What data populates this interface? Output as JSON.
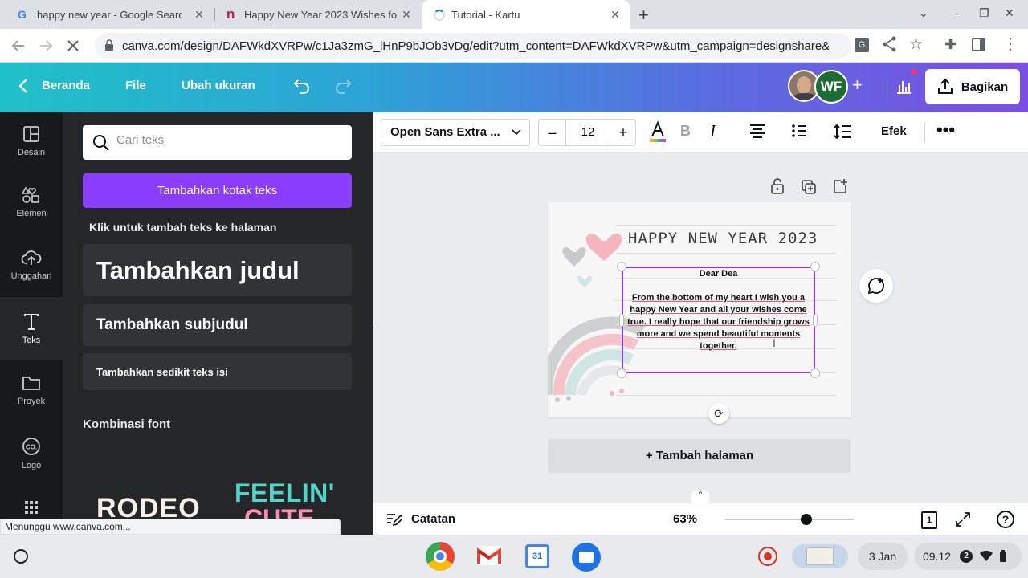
{
  "browser": {
    "tabs": [
      {
        "title": "happy new year - Google Search",
        "favicon": "google"
      },
      {
        "title": "Happy New Year 2023 Wishes fo",
        "favicon": "n-logo"
      },
      {
        "title": "Tutorial - Kartu",
        "favicon": "loading",
        "active": true
      }
    ],
    "url": "canva.com/design/DAFWkdXVRPw/c1Ja3zmG_lHnP9bJOb3vDg/edit?utm_content=DAFWkdXVRPw&utm_campaign=designshare&u...",
    "status": "Menunggu www.canva.com..."
  },
  "header": {
    "back_label": "Beranda",
    "file_label": "File",
    "resize_label": "Ubah ukuran",
    "avatar_initials": "WF",
    "share_label": "Bagikan"
  },
  "rail": [
    {
      "label": "Desain",
      "icon": "layout-icon"
    },
    {
      "label": "Elemen",
      "icon": "shapes-icon"
    },
    {
      "label": "Unggahan",
      "icon": "cloud-upload-icon"
    },
    {
      "label": "Teks",
      "icon": "text-icon",
      "active": true
    },
    {
      "label": "Proyek",
      "icon": "folder-icon"
    },
    {
      "label": "Logo",
      "icon": "logo-icon"
    }
  ],
  "panel": {
    "search_placeholder": "Cari teks",
    "add_textbox": "Tambahkan kotak teks",
    "hint": "Klik untuk tambah teks ke halaman",
    "heading": "Tambahkan judul",
    "subheading": "Tambahkan subjudul",
    "body": "Tambahkan sedikit teks isi",
    "combos_label": "Kombinasi font",
    "combo1": "RODEO",
    "combo2": "FEELIN'",
    "combo2b": "CUTE"
  },
  "toolbar": {
    "font": "Open Sans Extra ...",
    "size": "12",
    "effects": "Efek"
  },
  "card": {
    "title": "HAPPY NEW YEAR 2023",
    "greeting": "Dear Dea",
    "message": "From the bottom of my heart I wish you a happy New Year and all your wishes come true. I really hope that our friendship grows more and we spend beautiful moments together."
  },
  "workspace": {
    "add_page": "+ Tambah halaman"
  },
  "bottom": {
    "notes": "Catatan",
    "zoom": "63%",
    "zoom_fraction": 0.63,
    "page_count": "1"
  },
  "shelf": {
    "date": "3 Jan",
    "time": "09.12",
    "notifications": "2"
  },
  "colors": {
    "accent": "#8b3dff",
    "header_start": "#1fc1c8",
    "header_end": "#7b4fe3",
    "heart_pink": "#f4b6bd",
    "heart_grey": "#c7c9cb",
    "heart_mint": "#cfe6e2"
  }
}
